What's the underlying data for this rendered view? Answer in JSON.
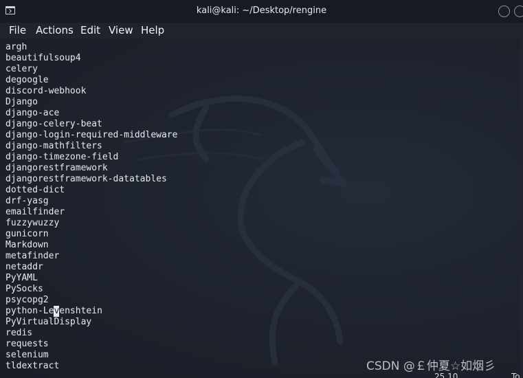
{
  "window": {
    "title": "kali@kali: ~/Desktop/rengine",
    "icon": "terminal-icon"
  },
  "menubar": {
    "file": "File",
    "actions": "Actions",
    "edit": "Edit",
    "view": "View",
    "help": "Help"
  },
  "terminal": {
    "lines": [
      "argh",
      "beautifulsoup4",
      "celery",
      "degoogle",
      "discord-webhook",
      "Django",
      "django-ace",
      "django-celery-beat",
      "django-login-required-middleware",
      "django-mathfilters",
      "django-timezone-field",
      "djangorestframework",
      "djangorestframework-datatables",
      "dotted-dict",
      "drf-yasg",
      "emailfinder",
      "fuzzywuzzy",
      "gunicorn",
      "Markdown",
      "metafinder",
      "netaddr",
      "PyYAML",
      "PySocks",
      "psycopg2"
    ],
    "cursor_line": {
      "before": "python-Le",
      "cursor_char": "v",
      "after": "enshtein"
    },
    "lines_after": [
      "PyVirtualDisplay",
      "redis",
      "requests",
      "selenium",
      "tldextract"
    ]
  },
  "watermark": "CSDN @￡仲夏☆如烟彡",
  "statusbar": {
    "position": "25,10",
    "scroll": "To"
  },
  "colors": {
    "background": "#1c212b",
    "titlebar": "#171a21",
    "text": "#e7e9ed",
    "cursor": "#e8eaee"
  }
}
